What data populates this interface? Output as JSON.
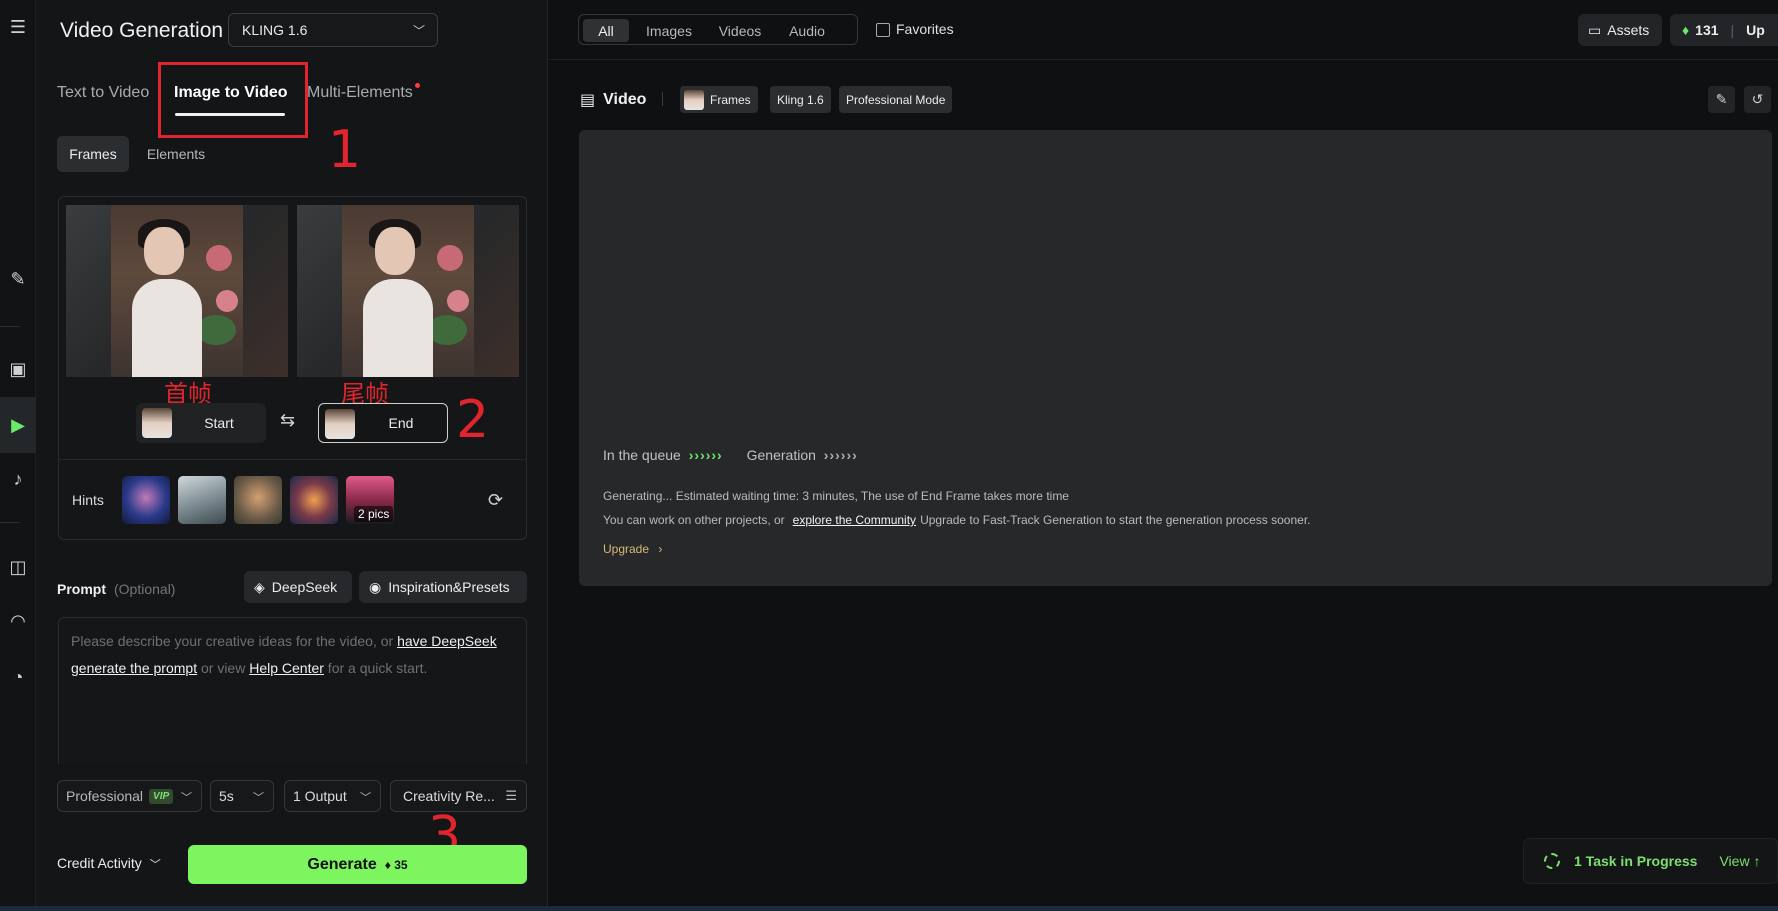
{
  "header": {
    "title": "Video Generation",
    "model": "KLING 1.6"
  },
  "tabs": [
    {
      "label": "Text to Video"
    },
    {
      "label": "Image to Video"
    },
    {
      "label": "Multi-Elements"
    }
  ],
  "subtabs": [
    {
      "label": "Frames"
    },
    {
      "label": "Elements"
    }
  ],
  "frames": {
    "start_label": "Start",
    "end_label": "End"
  },
  "annotations": {
    "one": "1",
    "two": "2",
    "three": "3",
    "start_cn": "首帧",
    "end_cn": "尾帧"
  },
  "hints": {
    "label": "Hints",
    "more": "2 pics"
  },
  "prompt": {
    "label": "Prompt",
    "optional": "(Optional)",
    "deepseek": "DeepSeek",
    "inspiration": "Inspiration&Presets",
    "ph1": "Please describe your creative ideas for the video, or ",
    "link1": "have DeepSeek generate the prompt",
    "ph2": " or view ",
    "link2": "Help Center",
    "ph3": " for a quick start."
  },
  "options": {
    "mode": "Professional",
    "vip": "VIP",
    "duration": "5s",
    "output": "1 Output",
    "creativity": "Creativity Re..."
  },
  "footer": {
    "credit_activity": "Credit Activity",
    "generate": "Generate",
    "cost": "35"
  },
  "topbar": {
    "filters": [
      {
        "label": "All"
      },
      {
        "label": "Images"
      },
      {
        "label": "Videos"
      },
      {
        "label": "Audio"
      }
    ],
    "favorites": "Favorites",
    "assets": "Assets",
    "credits": "131",
    "upgrade_short": "Up"
  },
  "result": {
    "section": "Video",
    "tags": [
      "Frames",
      "Kling 1.6",
      "Professional Mode"
    ],
    "queue": "In the queue",
    "generation": "Generation",
    "arrows": "››››››",
    "status": "Generating... Estimated waiting time: 3 minutes, The use of End Frame takes more time",
    "work_prefix": "You can work on other projects, or",
    "explore": "explore the Community",
    "work_suffix": "Upgrade to Fast-Track Generation to start the generation process sooner.",
    "upgrade": "Upgrade"
  },
  "task": {
    "label": "1 Task in Progress",
    "view": "View"
  },
  "colors": {
    "accent": "#7cf55f",
    "annotation": "#e0252e",
    "panel": "#141516",
    "card": "#262829"
  }
}
